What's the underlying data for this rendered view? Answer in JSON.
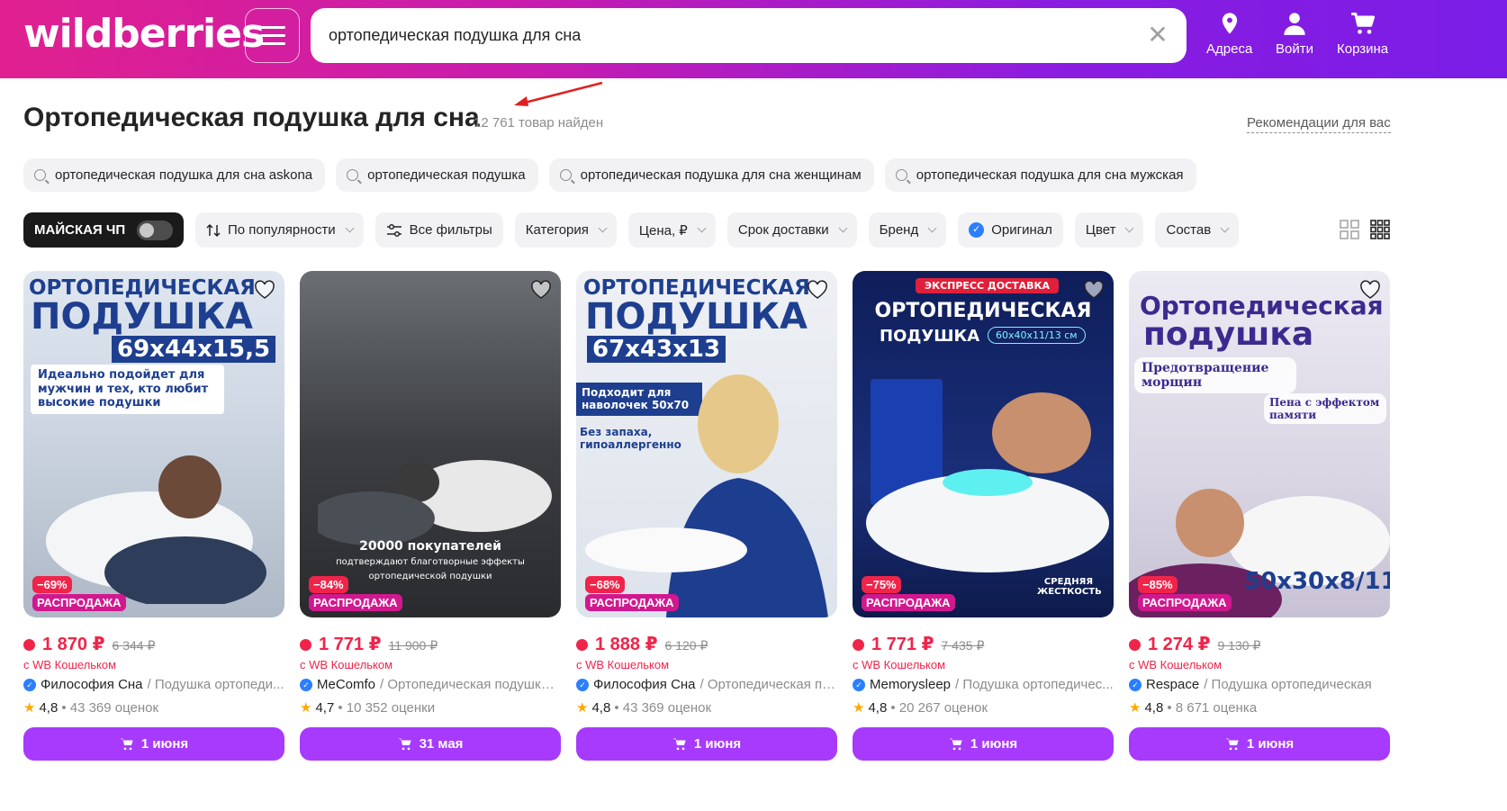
{
  "header": {
    "logo": "wildberries",
    "search_value": "ортопедическая подушка для сна",
    "nav": [
      {
        "label": "Адреса",
        "icon": "location-icon"
      },
      {
        "label": "Войти",
        "icon": "user-icon"
      },
      {
        "label": "Корзина",
        "icon": "cart-icon"
      }
    ]
  },
  "page": {
    "title": "Ортопедическая подушка для сна",
    "count": "12 761 товар найден",
    "recommendations": "Рекомендации для вас"
  },
  "suggestions": [
    "ортопедическая подушка для сна askona",
    "ортопедическая подушка",
    "ортопедическая подушка для сна женщинам",
    "ортопедическая подушка для сна мужская"
  ],
  "filters": {
    "promo": "МАЙСКАЯ ЧП",
    "sort": "По популярности",
    "all": "Все фильтры",
    "items": [
      "Категория",
      "Цена, ₽",
      "Срок доставки",
      "Бренд"
    ],
    "original": "Оригинал",
    "items2": [
      "Цвет",
      "Состав"
    ]
  },
  "products": [
    {
      "price": "1 870 ₽",
      "old_price": "6 344 ₽",
      "wallet": "с WB Кошельком",
      "brand": "Философия Сна",
      "name": " / Подушка ортопеди...",
      "rating": "4,8",
      "reviews": "• 43 369 оценок",
      "discount": "−69%",
      "sale": "РАСПРОДАЖА",
      "delivery": "1 июня",
      "img_text": [
        "ОРТОПЕДИЧЕСКАЯ",
        "ПОДУШКА",
        "69х44х15,5",
        "Идеально подойдет для мужчин и тех, кто любит высокие подушки"
      ]
    },
    {
      "price": "1 771 ₽",
      "old_price": "11 900 ₽",
      "wallet": "с WB Кошельком",
      "brand": "MeComfo",
      "name": " / Ортопедическая подушка ...",
      "rating": "4,7",
      "reviews": "• 10 352 оценки",
      "discount": "−84%",
      "sale": "РАСПРОДАЖА",
      "delivery": "31 мая",
      "img_text": [
        "20000 покупателей",
        "подтверждают благотворные эффекты",
        "ортопедической подушки"
      ]
    },
    {
      "price": "1 888 ₽",
      "old_price": "6 120 ₽",
      "wallet": "с WB Кошельком",
      "brand": "Философия Сна",
      "name": " / Ортопедическая по...",
      "rating": "4,8",
      "reviews": "• 43 369 оценок",
      "discount": "−68%",
      "sale": "РАСПРОДАЖА",
      "delivery": "1 июня",
      "img_text": [
        "ОРТОПЕДИЧЕСКАЯ",
        "ПОДУШКА",
        "67х43х13",
        "Подходит для наволочек 50х70",
        "Без запаха, гипоаллергенно"
      ]
    },
    {
      "price": "1 771 ₽",
      "old_price": "7 435 ₽",
      "wallet": "с WB Кошельком",
      "brand": "Memorysleep",
      "name": " / Подушка ортопедичес...",
      "rating": "4,8",
      "reviews": "• 20 267 оценок",
      "discount": "−75%",
      "sale": "РАСПРОДАЖА",
      "delivery": "1 июня",
      "img_text": [
        "ЭКСПРЕСС ДОСТАВКА",
        "ОРТОПЕДИЧЕСКАЯ",
        "ПОДУШКА",
        "60х40х11/13 см",
        "СРЕДНЯЯ ЖЕСТКОСТЬ"
      ]
    },
    {
      "price": "1 274 ₽",
      "old_price": "9 130 ₽",
      "wallet": "с WB Кошельком",
      "brand": "Respace",
      "name": " / Подушка ортопедическая",
      "rating": "4,8",
      "reviews": "• 8 671 оценка",
      "discount": "−85%",
      "sale": "РАСПРОДАЖА",
      "delivery": "1 июня",
      "img_text": [
        "Ортопедическая",
        "подушка",
        "Предотвращение морщин",
        "Пена с эффектом памяти",
        "50х30х8/11"
      ]
    }
  ]
}
